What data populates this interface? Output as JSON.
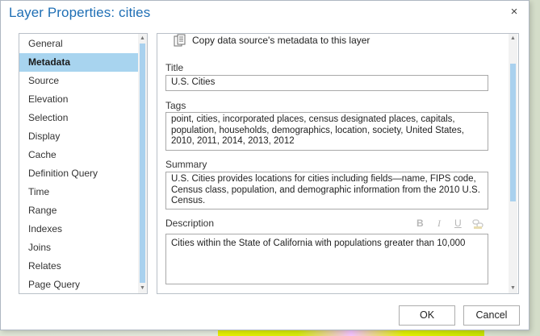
{
  "dialog": {
    "title": "Layer Properties: cities",
    "close_glyph": "×"
  },
  "nav": {
    "items": [
      {
        "label": "General",
        "selected": false
      },
      {
        "label": "Metadata",
        "selected": true
      },
      {
        "label": "Source",
        "selected": false
      },
      {
        "label": "Elevation",
        "selected": false
      },
      {
        "label": "Selection",
        "selected": false
      },
      {
        "label": "Display",
        "selected": false
      },
      {
        "label": "Cache",
        "selected": false
      },
      {
        "label": "Definition Query",
        "selected": false
      },
      {
        "label": "Time",
        "selected": false
      },
      {
        "label": "Range",
        "selected": false
      },
      {
        "label": "Indexes",
        "selected": false
      },
      {
        "label": "Joins",
        "selected": false
      },
      {
        "label": "Relates",
        "selected": false
      },
      {
        "label": "Page Query",
        "selected": false
      }
    ]
  },
  "metadata": {
    "copy_label": "Copy data source's metadata to this layer",
    "title_label": "Title",
    "title_value": "U.S. Cities",
    "tags_label": "Tags",
    "tags_value": "point, cities, incorporated places, census designated places, capitals, population, households, demographics, location, society, United States, 2010, 2011, 2014, 2013, 2012",
    "summary_label": "Summary",
    "summary_value": "U.S. Cities provides locations for cities including fields—name, FIPS code, Census class, population, and demographic information from the 2010 U.S. Census.",
    "description_label": "Description",
    "description_value": "Cities within the State of California with populations greater than 10,000",
    "format_buttons": {
      "bold": "B",
      "italic": "I",
      "underline": "U"
    }
  },
  "buttons": {
    "ok": "OK",
    "cancel": "Cancel"
  },
  "colors": {
    "title": "#1f6fb5",
    "selection": "#a8d4ef",
    "scroll_thumb": "#a9d1ee"
  }
}
